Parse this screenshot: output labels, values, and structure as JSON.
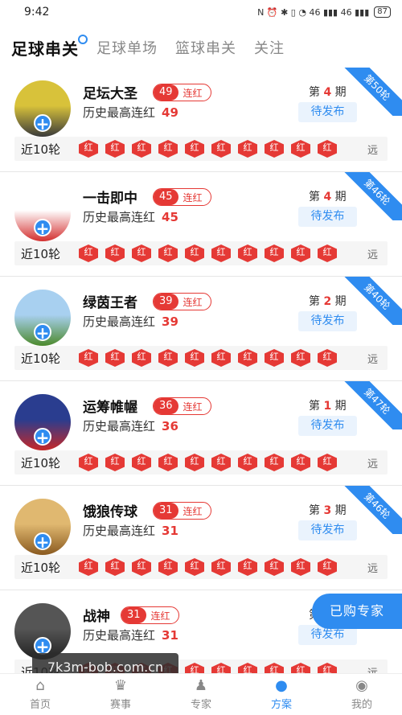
{
  "status_bar": {
    "time": "9:42",
    "icons": "N ⏰ ✱ ▯ ◔ 46 ▮▮▮ 46 ▮▮▮",
    "battery": "87"
  },
  "top_tabs": [
    {
      "label": "足球串关",
      "active": true
    },
    {
      "label": "足球单场",
      "active": false
    },
    {
      "label": "篮球串关",
      "active": false
    },
    {
      "label": "关注",
      "active": false
    }
  ],
  "experts": [
    {
      "name": "足坛大圣",
      "streak": "49",
      "streak_label": "连红",
      "history_label": "历史最高连红",
      "history_value": "49",
      "period_prefix": "第",
      "period_num": "4",
      "period_suffix": "期",
      "status": "待发布",
      "ribbon": "第50轮",
      "recent_label": "近10轮",
      "badges": [
        "红",
        "红",
        "红",
        "红",
        "红",
        "红",
        "红",
        "红",
        "红",
        "红"
      ],
      "far": "远",
      "avatar_colors": [
        "#d8c23a",
        "#3a3a3a"
      ]
    },
    {
      "name": "一击即中",
      "streak": "45",
      "streak_label": "连红",
      "history_label": "历史最高连红",
      "history_value": "45",
      "period_prefix": "第",
      "period_num": "4",
      "period_suffix": "期",
      "status": "待发布",
      "ribbon": "第46轮",
      "recent_label": "近10轮",
      "badges": [
        "红",
        "红",
        "红",
        "红",
        "红",
        "红",
        "红",
        "红",
        "红",
        "红"
      ],
      "far": "远",
      "avatar_colors": [
        "#ffffff",
        "#d32f2f"
      ]
    },
    {
      "name": "绿茵王者",
      "streak": "39",
      "streak_label": "连红",
      "history_label": "历史最高连红",
      "history_value": "39",
      "period_prefix": "第",
      "period_num": "2",
      "period_suffix": "期",
      "status": "待发布",
      "ribbon": "第40轮",
      "recent_label": "近10轮",
      "badges": [
        "红",
        "红",
        "红",
        "红",
        "红",
        "红",
        "红",
        "红",
        "红",
        "红"
      ],
      "far": "远",
      "avatar_colors": [
        "#a8d0f0",
        "#4c8a2c"
      ]
    },
    {
      "name": "运筹帷幄",
      "streak": "36",
      "streak_label": "连红",
      "history_label": "历史最高连红",
      "history_value": "36",
      "period_prefix": "第",
      "period_num": "1",
      "period_suffix": "期",
      "status": "待发布",
      "ribbon": "第47轮",
      "recent_label": "近10轮",
      "badges": [
        "红",
        "红",
        "红",
        "红",
        "红",
        "红",
        "红",
        "红",
        "红",
        "红"
      ],
      "far": "远",
      "avatar_colors": [
        "#2a3d8f",
        "#c62828"
      ]
    },
    {
      "name": "饿狼传球",
      "streak": "31",
      "streak_label": "连红",
      "history_label": "历史最高连红",
      "history_value": "31",
      "period_prefix": "第",
      "period_num": "3",
      "period_suffix": "期",
      "status": "待发布",
      "ribbon": "第46轮",
      "recent_label": "近10轮",
      "badges": [
        "红",
        "红",
        "红",
        "红",
        "红",
        "红",
        "红",
        "红",
        "红",
        "红"
      ],
      "far": "远",
      "avatar_colors": [
        "#e0b870",
        "#8a5a20"
      ]
    },
    {
      "name": "战神",
      "streak": "31",
      "streak_label": "连红",
      "history_label": "历史最高连红",
      "history_value": "31",
      "period_prefix": "第",
      "period_num": "",
      "period_suffix": "",
      "status": "待发布",
      "ribbon": "",
      "recent_label": "近10轮",
      "badges": [
        "红",
        "红",
        "红",
        "红",
        "红",
        "红",
        "红",
        "红",
        "红",
        "红"
      ],
      "far": "远",
      "avatar_colors": [
        "#555555",
        "#222222"
      ]
    }
  ],
  "float_button": "已购专家",
  "watermark": "7k3m-bob.com.cn",
  "tabbar": [
    {
      "label": "首页",
      "icon": "home-icon",
      "glyph": "⌂",
      "active": false
    },
    {
      "label": "赛事",
      "icon": "trophy-icon",
      "glyph": "♛",
      "active": false
    },
    {
      "label": "专家",
      "icon": "expert-icon",
      "glyph": "♟",
      "active": false
    },
    {
      "label": "方案",
      "icon": "plan-icon",
      "glyph": "●",
      "active": true
    },
    {
      "label": "我的",
      "icon": "profile-icon",
      "glyph": "◉",
      "active": false
    }
  ],
  "colors": {
    "accent": "#2f8cf0",
    "red": "#e53935"
  }
}
